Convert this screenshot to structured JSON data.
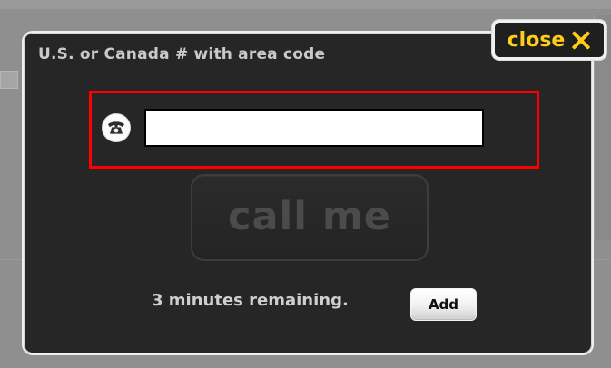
{
  "dialog": {
    "title": "U.S. or Canada # with area code",
    "close_label": "close",
    "close_icon": "close-icon",
    "phone_icon": "phone-icon",
    "phone_value": "",
    "call_label": "call me",
    "remaining_text": "3 minutes remaining.",
    "add_label": "Add"
  },
  "colors": {
    "dialog_background": "#262626",
    "dialog_border": "#efefef",
    "close_text": "#ffcc18",
    "highlight_border": "#ff0000",
    "disabled_call_text": "#4b4b4b"
  }
}
